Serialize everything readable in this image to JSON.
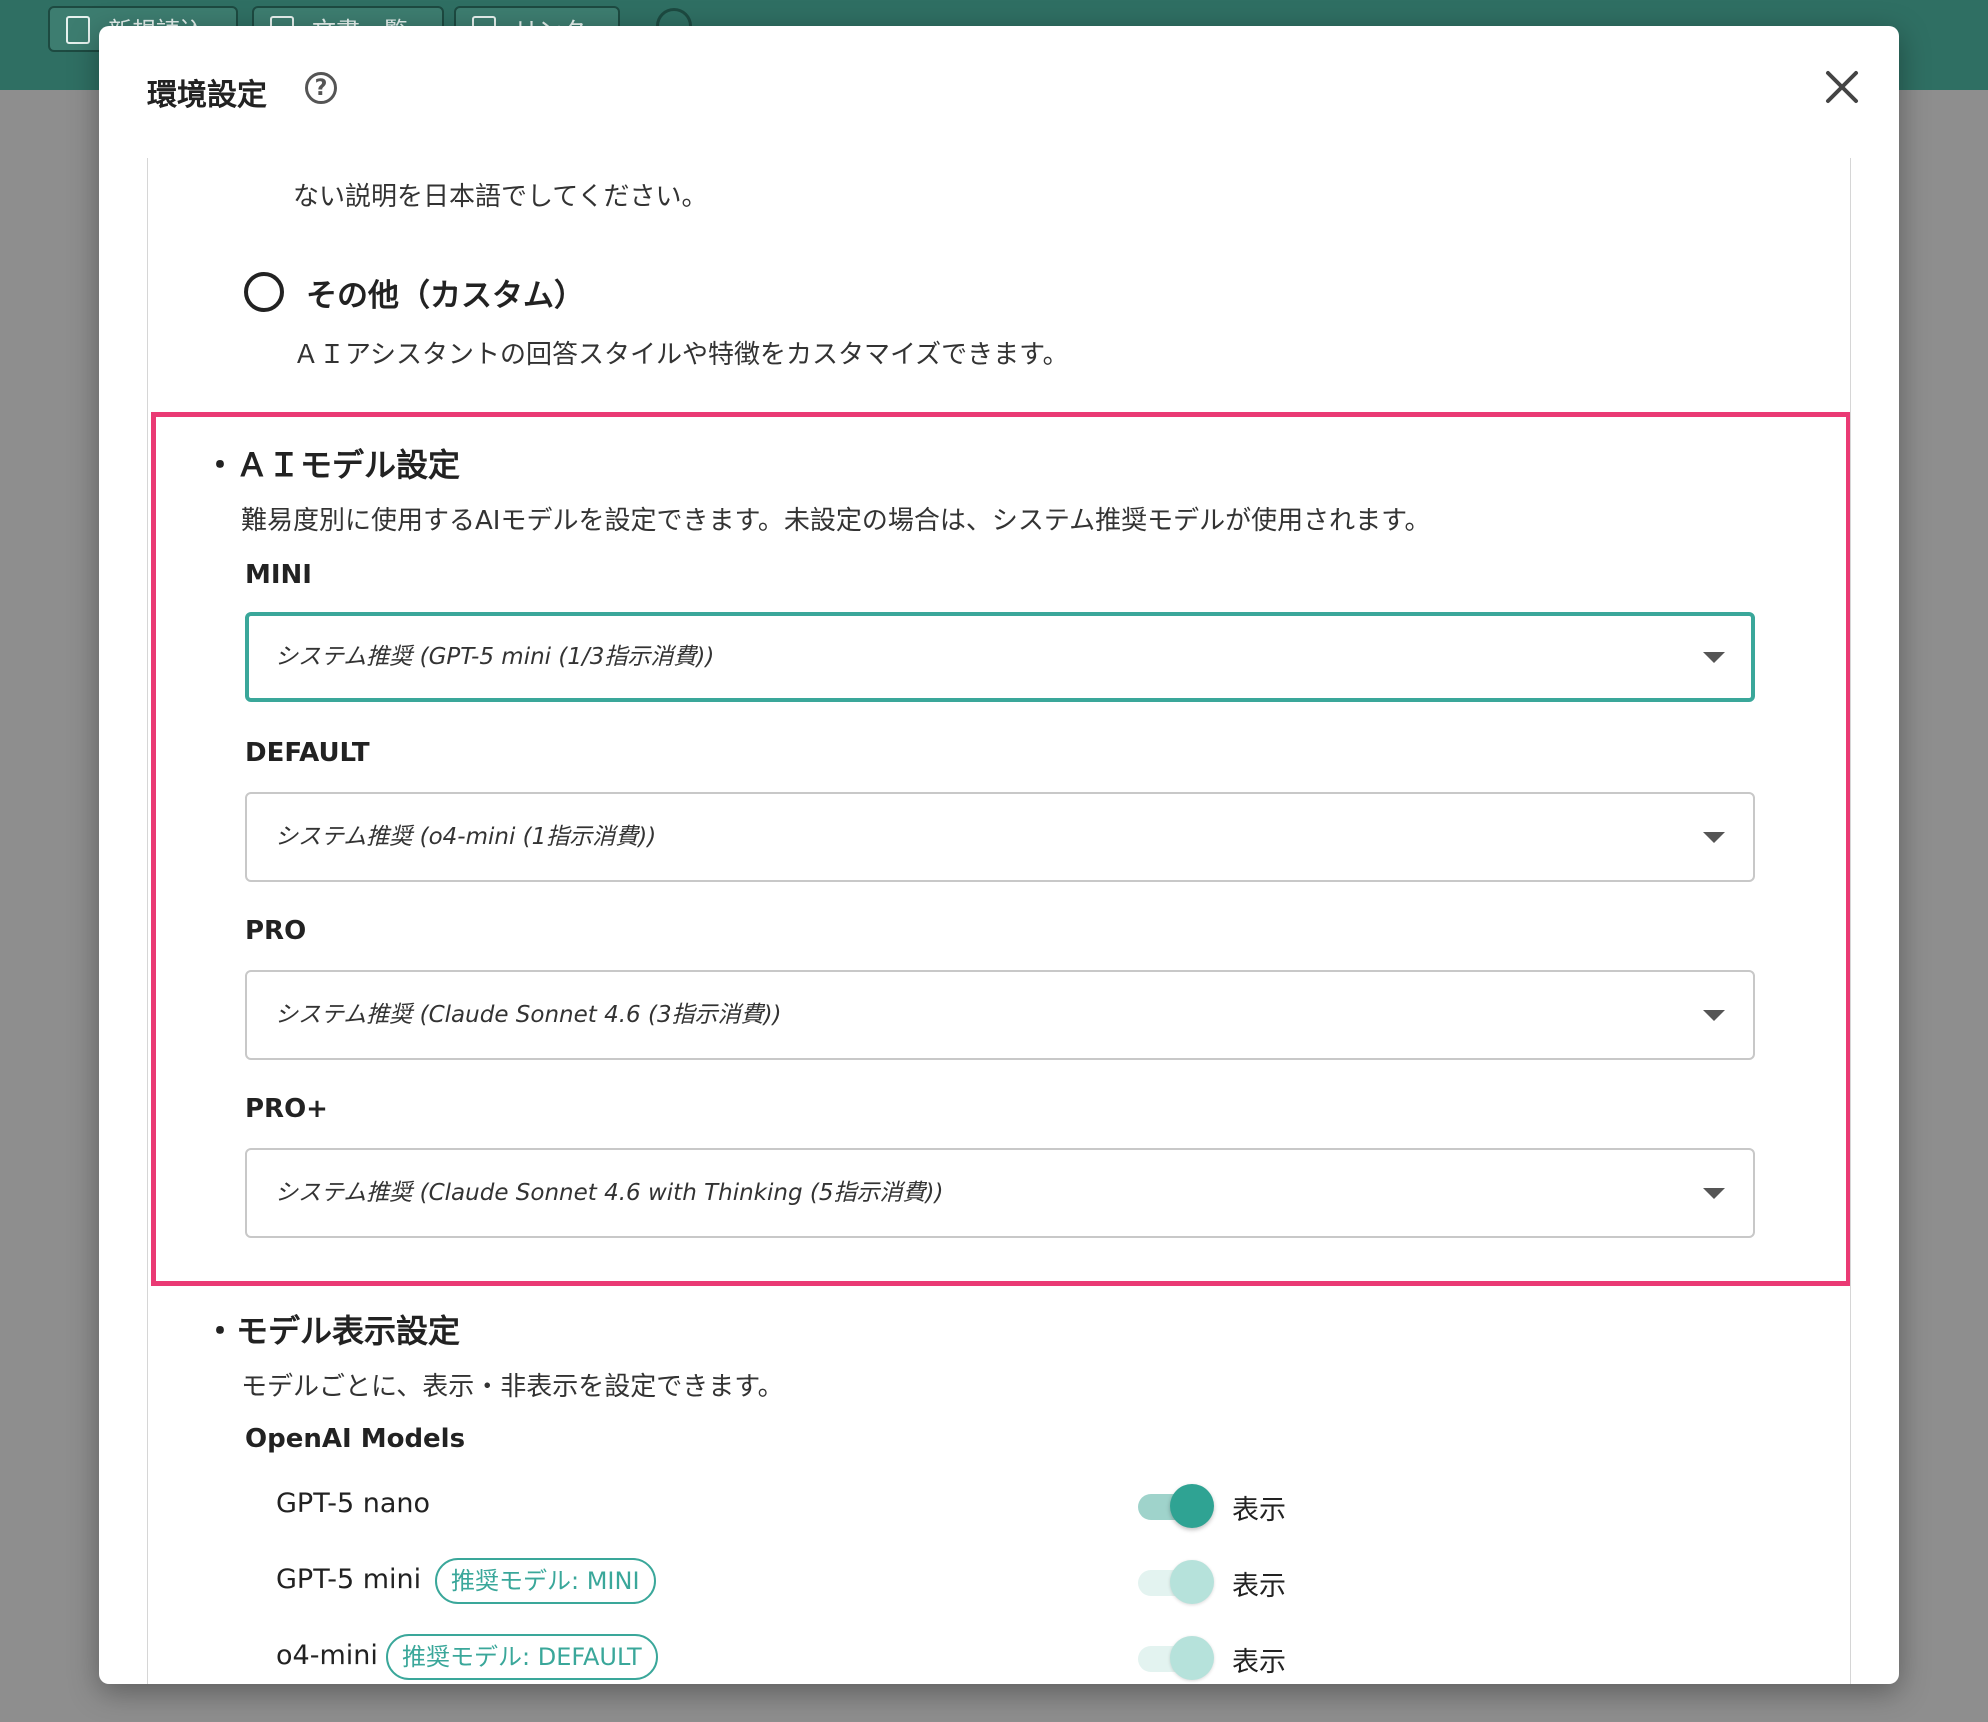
{
  "appbar": {
    "buttons": [
      "新規読込",
      "文書一覧",
      "リンク"
    ]
  },
  "dialog": {
    "title": "環境設定",
    "help_icon": "question-circle-icon",
    "close_icon": "close-icon"
  },
  "style_section": {
    "prev_desc_tail": "ない説明を日本語でしてください。",
    "custom_option_label": "その他（カスタム）",
    "custom_option_desc": "ＡＩアシスタントの回答スタイルや特徴をカスタマイズできます。"
  },
  "ai_model_section": {
    "title": "・ＡＩモデル設定",
    "description": "難易度別に使用するAIモデルを設定できます。未設定の場合は、システム推奨モデルが使用されます。",
    "selects": [
      {
        "label": "MINI",
        "value": "システム推奨 (GPT-5 mini (1/3指示消費))"
      },
      {
        "label": "DEFAULT",
        "value": "システム推奨 (o4-mini (1指示消費))"
      },
      {
        "label": "PRO",
        "value": "システム推奨 (Claude Sonnet 4.6 (3指示消費))"
      },
      {
        "label": "PRO+",
        "value": "システム推奨 (Claude Sonnet 4.6 with Thinking (5指示消費))"
      }
    ]
  },
  "model_display_section": {
    "title": "・モデル表示設定",
    "description": "モデルごとに、表示・非表示を設定できます。",
    "group_title": "OpenAI Models",
    "models": [
      {
        "name": "GPT-5 nano",
        "badge": "",
        "toggle_label": "表示",
        "enabled": true
      },
      {
        "name": "GPT-5 mini",
        "badge": "推奨モデル: MINI",
        "toggle_label": "表示",
        "enabled": true
      },
      {
        "name": "o4-mini",
        "badge": "推奨モデル: DEFAULT",
        "toggle_label": "表示",
        "enabled": true
      }
    ]
  },
  "colors": {
    "accent": "#3aa79a",
    "highlight_border": "#ea3a74",
    "appbar": "#2f6f63"
  }
}
